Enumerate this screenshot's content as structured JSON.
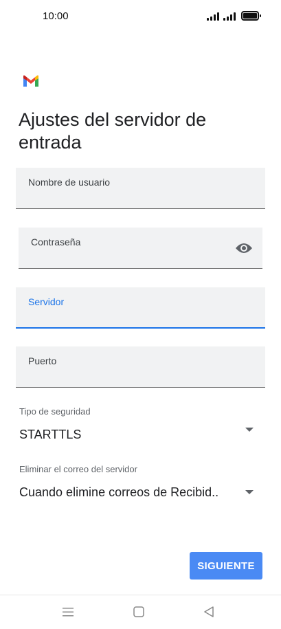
{
  "status_bar": {
    "time": "10:00"
  },
  "app": {
    "logo": "gmail-logo"
  },
  "title": "Ajustes del servidor de entrada",
  "fields": {
    "username": {
      "label": "Nombre de usuario",
      "value": ""
    },
    "password": {
      "label": "Contraseña",
      "value": "",
      "icon": "eye-icon"
    },
    "server": {
      "label": "Servidor",
      "value": ""
    },
    "port": {
      "label": "Puerto",
      "value": ""
    }
  },
  "security": {
    "caption": "Tipo de seguridad",
    "value": "STARTTLS"
  },
  "delete_policy": {
    "caption": "Eliminar el correo del servidor",
    "value": "Cuando elimine correos de Recibid.."
  },
  "actions": {
    "next_label": "SIGUIENTE"
  },
  "colors": {
    "accent": "#1a73e8",
    "button": "#4a8af4",
    "field_bg": "#f1f2f3"
  },
  "nav": {
    "icons": [
      "menu-icon",
      "home-icon",
      "back-icon"
    ]
  }
}
